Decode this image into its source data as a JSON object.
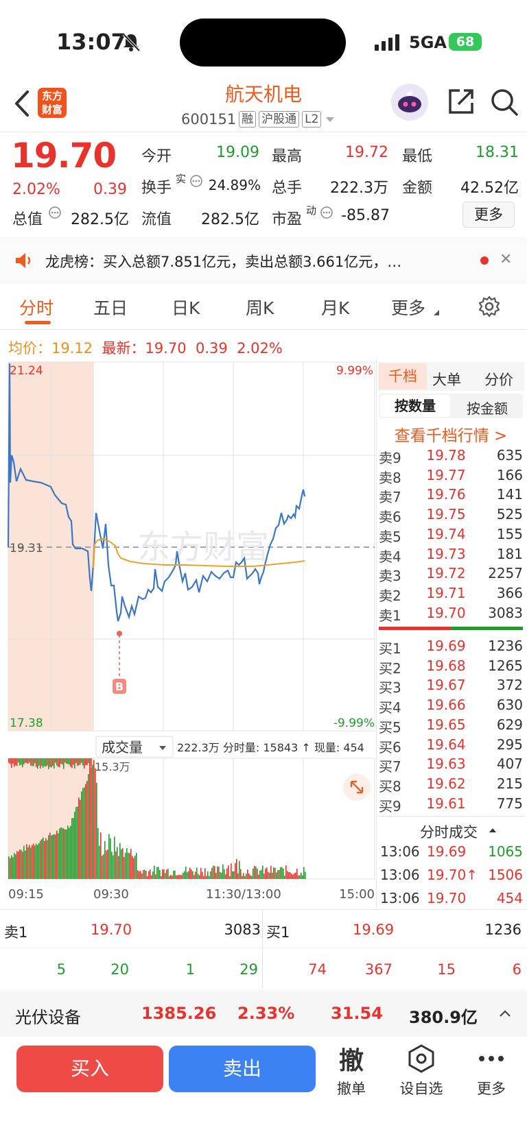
{
  "status": {
    "time": "13:07",
    "network": "5GA",
    "battery": "68"
  },
  "header": {
    "logo_line1": "东方",
    "logo_line2": "财富",
    "name": "航天机电",
    "code": "600151",
    "tags": [
      "融",
      "沪股通",
      "L2"
    ]
  },
  "quote": {
    "price": "19.70",
    "pct": "2.02%",
    "change": "0.39",
    "open_label": "今开",
    "open": "19.09",
    "high_label": "最高",
    "high": "19.72",
    "low_label": "最低",
    "low": "18.31",
    "turnover_label": "换手",
    "turnover_sup": "实",
    "turnover": "24.89%",
    "volume_label": "总手",
    "volume": "222.3万",
    "amount_label": "金额",
    "amount": "42.52亿",
    "mktcap_label": "总值",
    "mktcap": "282.5亿",
    "float_label": "流值",
    "float": "282.5亿",
    "pe_label": "市盈",
    "pe_sup": "动",
    "pe": "-85.87",
    "more": "更多"
  },
  "news": {
    "text": "龙虎榜：买入总额7.851亿元，卖出总额3.661亿元，…",
    "close": "✕"
  },
  "tabs": [
    "分时",
    "五日",
    "日K",
    "周K",
    "月K",
    "更多"
  ],
  "info_line": {
    "avg_label": "均价：",
    "avg": "19.12",
    "latest_label": "最新：",
    "latest": "19.70",
    "change": "0.39",
    "pct": "2.02%"
  },
  "chart": {
    "y_top": "21.24",
    "y_mid": "19.31",
    "y_bottom": "17.38",
    "pct_top": "9.99%",
    "pct_bottom": "-9.99%",
    "watermark": "东方财富",
    "marker": "B",
    "volume_selector": "成交量",
    "volume_summary": "222.3万 分时量: 15843 ↑ 现量: 454",
    "volume_max": "15.3万",
    "time_labels": [
      "09:15",
      "09:30",
      "11:30/13:00",
      "15:00"
    ]
  },
  "orderbook": {
    "tabs": [
      "千档",
      "大单",
      "分价"
    ],
    "subtabs": [
      "按数量",
      "按金额"
    ],
    "link": "查看千档行情 >",
    "asks": [
      {
        "label": "卖9",
        "price": "19.78",
        "vol": "635"
      },
      {
        "label": "卖8",
        "price": "19.77",
        "vol": "166"
      },
      {
        "label": "卖7",
        "price": "19.76",
        "vol": "141"
      },
      {
        "label": "卖6",
        "price": "19.75",
        "vol": "525"
      },
      {
        "label": "卖5",
        "price": "19.74",
        "vol": "155"
      },
      {
        "label": "卖4",
        "price": "19.73",
        "vol": "181"
      },
      {
        "label": "卖3",
        "price": "19.72",
        "vol": "2257"
      },
      {
        "label": "卖2",
        "price": "19.71",
        "vol": "366"
      },
      {
        "label": "卖1",
        "price": "19.70",
        "vol": "3083"
      }
    ],
    "bids": [
      {
        "label": "买1",
        "price": "19.69",
        "vol": "1236"
      },
      {
        "label": "买2",
        "price": "19.68",
        "vol": "1265"
      },
      {
        "label": "买3",
        "price": "19.67",
        "vol": "372"
      },
      {
        "label": "买4",
        "price": "19.66",
        "vol": "630"
      },
      {
        "label": "买5",
        "price": "19.65",
        "vol": "629"
      },
      {
        "label": "买6",
        "price": "19.64",
        "vol": "295"
      },
      {
        "label": "买7",
        "price": "19.63",
        "vol": "407"
      },
      {
        "label": "买8",
        "price": "19.62",
        "vol": "215"
      },
      {
        "label": "买9",
        "price": "19.61",
        "vol": "775"
      }
    ],
    "trades_title": "分时成交",
    "trades": [
      {
        "time": "13:06",
        "price": "19.69",
        "vol": "1065"
      },
      {
        "time": "13:06",
        "price": "19.70↑",
        "vol": "1506"
      },
      {
        "time": "13:06",
        "price": "19.70",
        "vol": "454"
      }
    ]
  },
  "level1": {
    "sell_label": "卖1",
    "sell_price": "19.70",
    "sell_vol": "3083",
    "buy_label": "买1",
    "buy_price": "19.69",
    "buy_vol": "1236",
    "sell_counts": [
      "5",
      "20",
      "1",
      "29"
    ],
    "buy_counts": [
      "74",
      "367",
      "15",
      "6"
    ]
  },
  "sector": {
    "name": "光伏设备",
    "index": "1385.26",
    "pct": "2.33%",
    "change": "31.54",
    "amount": "380.9亿"
  },
  "actions": {
    "buy": "买入",
    "sell": "卖出",
    "cancel_big": "撤",
    "cancel": "撤单",
    "watch": "设自选",
    "more": "更多"
  }
}
